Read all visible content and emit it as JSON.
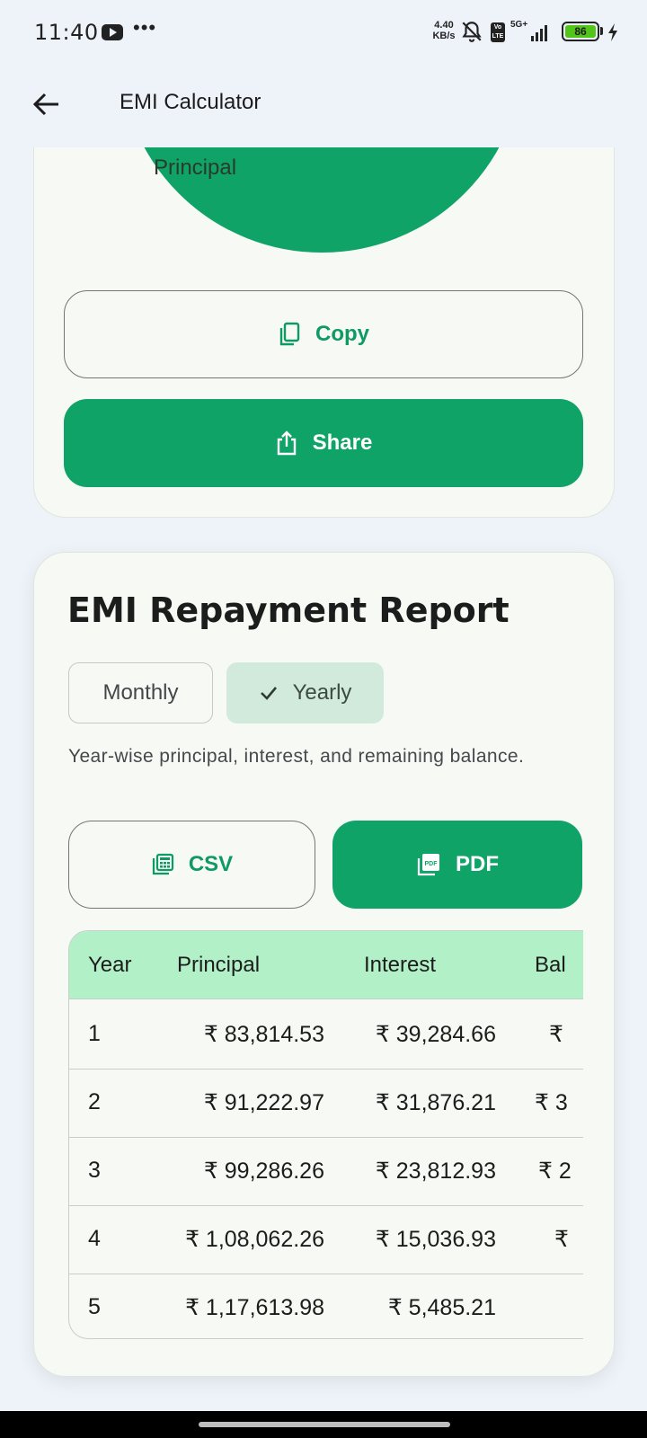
{
  "status_bar": {
    "time": "11:40",
    "overflow_dots": "•••",
    "net_speed_value": "4.40",
    "net_speed_unit": "KB/s",
    "volte": "Vo LTE",
    "network": "5G+",
    "battery": "86"
  },
  "app_bar": {
    "title": "EMI Calculator"
  },
  "chart": {
    "label": "Principal",
    "principal_color": "#0fa368"
  },
  "actions": {
    "copy_label": "Copy",
    "share_label": "Share"
  },
  "report": {
    "title": "EMI Repayment Report",
    "segments": {
      "monthly": "Monthly",
      "yearly": "Yearly",
      "selected": "yearly"
    },
    "description": "Year-wise principal, interest, and remaining balance.",
    "export": {
      "csv_label": "CSV",
      "pdf_label": "PDF"
    },
    "table": {
      "headers": [
        "Year",
        "Principal",
        "Interest",
        "Bal"
      ],
      "rows": [
        {
          "year": "1",
          "principal": "₹ 83,814.53",
          "interest": "₹ 39,284.66",
          "balance": "₹"
        },
        {
          "year": "2",
          "principal": "₹ 91,222.97",
          "interest": "₹ 31,876.21",
          "balance": "₹ 3"
        },
        {
          "year": "3",
          "principal": "₹ 99,286.26",
          "interest": "₹ 23,812.93",
          "balance": "₹ 2"
        },
        {
          "year": "4",
          "principal": "₹ 1,08,062.26",
          "interest": "₹ 15,036.93",
          "balance": "₹"
        },
        {
          "year": "5",
          "principal": "₹ 1,17,613.98",
          "interest": "₹ 5,485.21",
          "balance": ""
        }
      ]
    }
  },
  "colors": {
    "accent": "#0fa368",
    "table_header": "#b2f0c8",
    "chip_selected": "#d2eadc"
  }
}
